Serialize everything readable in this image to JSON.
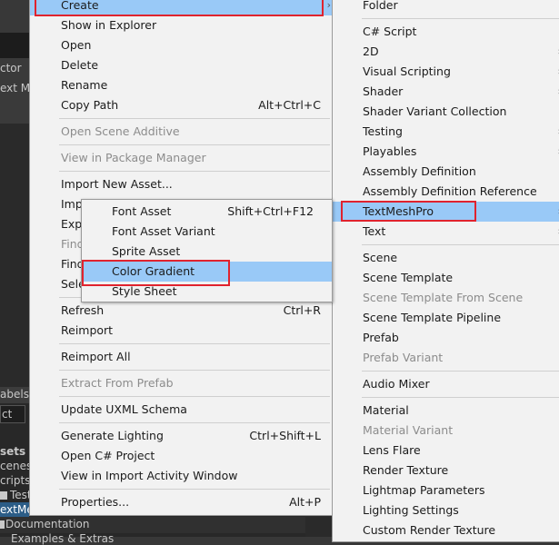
{
  "background": {
    "left_labels": [
      "ctor",
      "ext M",
      "abels",
      "ct",
      "sets",
      "cenes",
      "cripts",
      "Test",
      "extMe",
      "Documentation",
      "Examples & Extras"
    ]
  },
  "main_menu": [
    {
      "label": "Create",
      "highlighted": true,
      "submenu": true
    },
    {
      "label": "Show in Explorer"
    },
    {
      "label": "Open"
    },
    {
      "label": "Delete"
    },
    {
      "label": "Rename"
    },
    {
      "label": "Copy Path",
      "shortcut": "Alt+Ctrl+C"
    },
    {
      "label": "Open Scene Additive",
      "disabled": true
    },
    {
      "label": "View in Package Manager",
      "disabled": true
    },
    {
      "label": "Import New Asset..."
    },
    {
      "label": "Import Package"
    },
    {
      "label": "Export Package..."
    },
    {
      "label": "Find References In Scene",
      "disabled": true
    },
    {
      "label": "Find References In Project"
    },
    {
      "label": "Select Dependencies"
    },
    {
      "label": "Refresh",
      "shortcut": "Ctrl+R"
    },
    {
      "label": "Reimport"
    },
    {
      "label": "Reimport All"
    },
    {
      "label": "Extract From Prefab",
      "disabled": true
    },
    {
      "label": "Update UXML Schema"
    },
    {
      "label": "Generate Lighting",
      "shortcut": "Ctrl+Shift+L"
    },
    {
      "label": "Open C# Project"
    },
    {
      "label": "View in Import Activity Window"
    },
    {
      "label": "Properties...",
      "shortcut": "Alt+P"
    }
  ],
  "main_menu_visible_text": {
    "import": "Imp",
    "export": "Expo",
    "find_ref_scene": "Find",
    "find_ref_project": "Find",
    "select": "Sele"
  },
  "textmeshpro_submenu": [
    {
      "label": "Font Asset",
      "shortcut": "Shift+Ctrl+F12"
    },
    {
      "label": "Font Asset Variant"
    },
    {
      "label": "Sprite Asset"
    },
    {
      "label": "Color Gradient",
      "highlighted": true
    },
    {
      "label": "Style Sheet"
    }
  ],
  "create_submenu": [
    {
      "label": "Folder"
    },
    {
      "label": "C# Script"
    },
    {
      "label": "2D",
      "submenu": true
    },
    {
      "label": "Visual Scripting",
      "submenu": true
    },
    {
      "label": "Shader",
      "submenu": true
    },
    {
      "label": "Shader Variant Collection"
    },
    {
      "label": "Testing",
      "submenu": true
    },
    {
      "label": "Playables",
      "submenu": true
    },
    {
      "label": "Assembly Definition"
    },
    {
      "label": "Assembly Definition Reference"
    },
    {
      "label": "TextMeshPro",
      "highlighted": true,
      "submenu": true
    },
    {
      "label": "Text",
      "submenu": true
    },
    {
      "label": "Scene"
    },
    {
      "label": "Scene Template"
    },
    {
      "label": "Scene Template From Scene",
      "disabled": true
    },
    {
      "label": "Scene Template Pipeline"
    },
    {
      "label": "Prefab"
    },
    {
      "label": "Prefab Variant",
      "disabled": true
    },
    {
      "label": "Audio Mixer"
    },
    {
      "label": "Material"
    },
    {
      "label": "Material Variant",
      "disabled": true
    },
    {
      "label": "Lens Flare"
    },
    {
      "label": "Render Texture"
    },
    {
      "label": "Lightmap Parameters"
    },
    {
      "label": "Lighting Settings"
    },
    {
      "label": "Custom Render Texture"
    }
  ],
  "colors": {
    "highlight": "#99c9f7",
    "annotation_box": "#e0232e",
    "menu_bg": "#f2f2f2"
  }
}
